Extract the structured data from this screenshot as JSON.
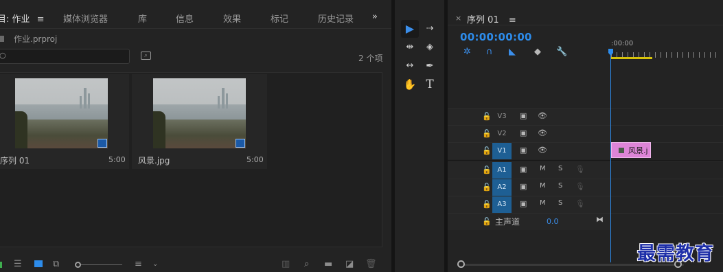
{
  "project_panel": {
    "tabs": [
      {
        "label": "目: 作业",
        "icon": "menu-icon"
      },
      {
        "label": "媒体浏览器"
      },
      {
        "label": "库"
      },
      {
        "label": "信息"
      },
      {
        "label": "效果"
      },
      {
        "label": "标记"
      },
      {
        "label": "历史记录"
      }
    ],
    "overflow_glyph": "»",
    "project_file": "作业.prproj",
    "search": {
      "value": "",
      "placeholder": ""
    },
    "item_count": "2 个项",
    "items": [
      {
        "name": "序列 01",
        "duration": "5:00",
        "badge_icon": "sequence-badge-icon"
      },
      {
        "name": "风景.jpg",
        "duration": "5:00",
        "badge_icon": "image-badge-icon"
      }
    ],
    "bottom_toolbar": [
      "list-view-icon",
      "icon-view-icon",
      "freeform-view-icon",
      "zoom-slider",
      "sort-icon",
      "automate-icon",
      "find-icon",
      "new-bin-icon",
      "new-item-icon",
      "trash-icon"
    ]
  },
  "tools": [
    "selection-tool",
    "track-select-tool",
    "ripple-edit-tool",
    "razor-tool",
    "slip-tool",
    "pen-tool",
    "hand-tool",
    "type-tool"
  ],
  "timeline": {
    "sequence_tab": "序列 01",
    "close_glyph": "×",
    "timecode": "00:00:00:00",
    "ruler_start": ":00:00",
    "video_tracks": [
      {
        "name": "V3",
        "targeted": false
      },
      {
        "name": "V2",
        "targeted": false
      },
      {
        "name": "V1",
        "targeted": true
      }
    ],
    "audio_tracks": [
      {
        "name": "A1",
        "mute": "M",
        "solo": "S"
      },
      {
        "name": "A2",
        "mute": "M",
        "solo": "S"
      },
      {
        "name": "A3",
        "mute": "M",
        "solo": "S"
      }
    ],
    "master": {
      "label": "主声道",
      "value": "0.0"
    },
    "clip": {
      "name": "风景.j",
      "track": "V1",
      "color": "#dd84d7"
    }
  },
  "watermark": "最需教育",
  "colors": {
    "accent": "#2d8ceb",
    "track_target": "#1e5f94",
    "clip": "#dd84d7",
    "work_area": "#d6c20a"
  }
}
